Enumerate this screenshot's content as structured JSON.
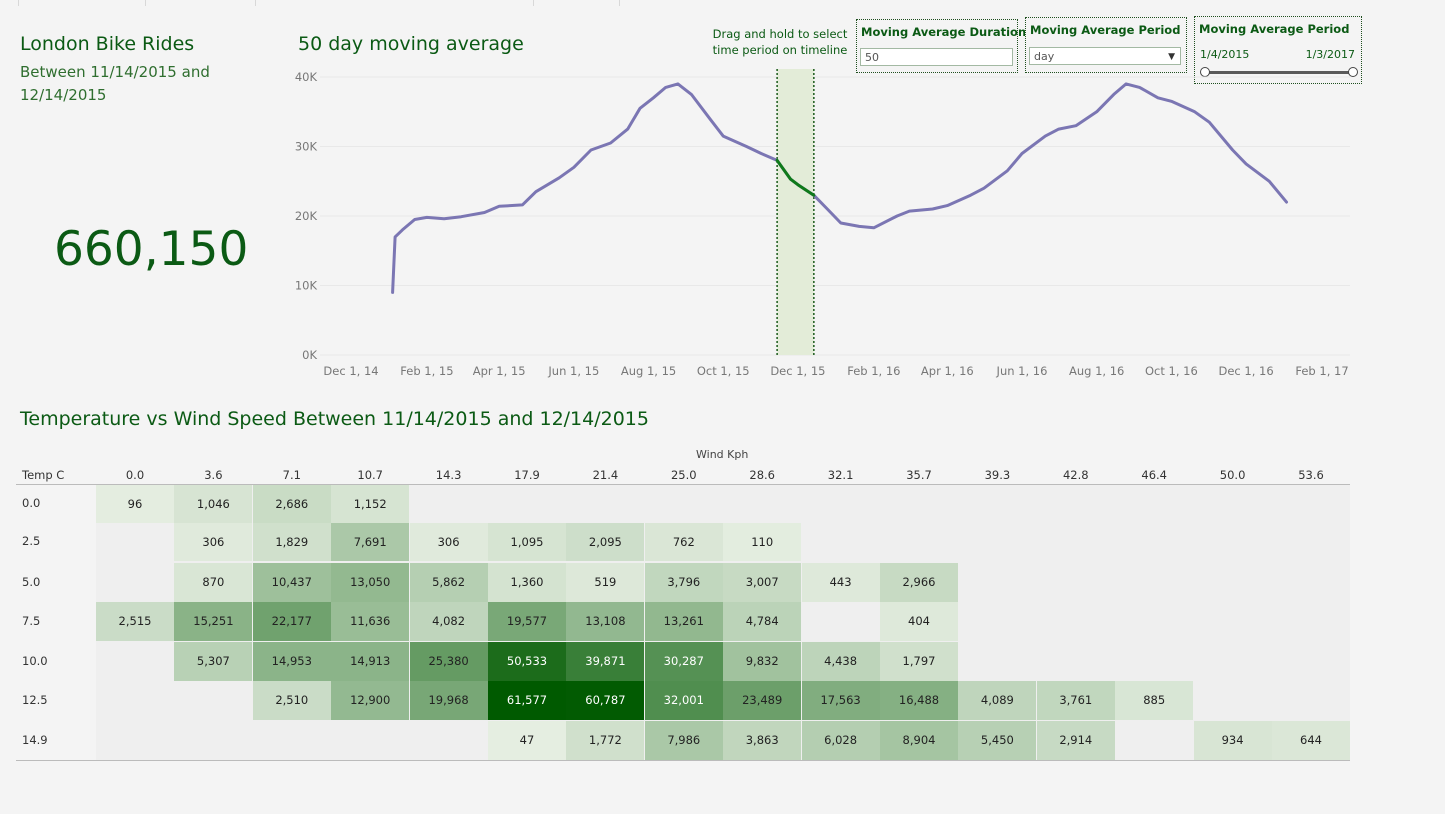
{
  "header": {
    "title": "London Bike Rides",
    "subtitle": "Between 11/14/2015 and 12/14/2015",
    "kpi_value": "660,150"
  },
  "line_chart": {
    "title": "50 day moving average",
    "hint": "Drag and hold to select time period on timeline"
  },
  "params": {
    "duration": {
      "label": "Moving Average Duration",
      "value": "50"
    },
    "period": {
      "label": "Moving Average Period",
      "value": "day"
    },
    "range": {
      "label": "Moving Average Period",
      "start": "1/4/2015",
      "end": "1/3/2017"
    }
  },
  "heatmap": {
    "title": "Temperature vs Wind Speed Between 11/14/2015 and 12/14/2015",
    "x_title": "Wind Kph",
    "y_title": "Temp C"
  },
  "colors": {
    "line": "#7b76b3",
    "highlight_line": "#0f7a1a",
    "selection_band": "#e3ecd8",
    "title_green": "#0b5a14",
    "heat_low": "#e7efe3",
    "heat_high": "#005a00"
  },
  "chart_data": [
    {
      "type": "line",
      "title": "50 day moving average",
      "x_ticks": [
        "Dec 1, 14",
        "Feb 1, 15",
        "Apr 1, 15",
        "Jun 1, 15",
        "Aug 1, 15",
        "Oct 1, 15",
        "Dec 1, 15",
        "Feb 1, 16",
        "Apr 1, 16",
        "Jun 1, 16",
        "Aug 1, 16",
        "Oct 1, 16",
        "Dec 1, 16",
        "Feb 1, 17"
      ],
      "y_ticks": [
        "0K",
        "10K",
        "20K",
        "30K",
        "40K"
      ],
      "ylim": [
        0,
        40000
      ],
      "xlim": [
        "2014-12-01",
        "2017-02-01"
      ],
      "selection": {
        "start": "2015-11-14",
        "end": "2015-12-14"
      },
      "series": [
        {
          "x": [
            "2015-01-04",
            "2015-01-06",
            "2015-01-12",
            "2015-01-22",
            "2015-02-01",
            "2015-02-15",
            "2015-03-01",
            "2015-03-20",
            "2015-04-01",
            "2015-04-20",
            "2015-05-01",
            "2015-05-20",
            "2015-06-01",
            "2015-06-15",
            "2015-07-01",
            "2015-07-15",
            "2015-07-25",
            "2015-08-05",
            "2015-08-15",
            "2015-08-25",
            "2015-09-05",
            "2015-09-20",
            "2015-10-01",
            "2015-10-20",
            "2015-11-01",
            "2015-11-14",
            "2015-11-25",
            "2015-12-01",
            "2015-12-14",
            "2015-12-25",
            "2016-01-05",
            "2016-01-20",
            "2016-02-01",
            "2016-02-20",
            "2016-03-01",
            "2016-03-20",
            "2016-04-01",
            "2016-04-20",
            "2016-05-01",
            "2016-05-20",
            "2016-06-01",
            "2016-06-20",
            "2016-07-01",
            "2016-07-15",
            "2016-08-01",
            "2016-08-15",
            "2016-08-25",
            "2016-09-05",
            "2016-09-20",
            "2016-10-01",
            "2016-10-20",
            "2016-11-01",
            "2016-11-20",
            "2016-12-01",
            "2016-12-20",
            "2017-01-03"
          ],
          "y": [
            9000,
            17000,
            18000,
            19500,
            19800,
            19600,
            19900,
            20500,
            21400,
            21600,
            23500,
            25500,
            27000,
            29500,
            30500,
            32500,
            35500,
            37000,
            38500,
            39000,
            37500,
            34000,
            31500,
            30000,
            29000,
            28000,
            25300,
            24500,
            23000,
            21000,
            19000,
            18500,
            18300,
            20000,
            20700,
            21000,
            21500,
            23000,
            24000,
            26500,
            29000,
            31500,
            32500,
            33000,
            35000,
            37500,
            39000,
            38500,
            37000,
            36500,
            35000,
            33500,
            29500,
            27500,
            25000,
            22000
          ]
        }
      ]
    },
    {
      "type": "heatmap",
      "title": "Temperature vs Wind Speed Between 11/14/2015 and 12/14/2015",
      "xlabel": "Wind Kph",
      "ylabel": "Temp C",
      "x": [
        "0.0",
        "3.6",
        "7.1",
        "10.7",
        "14.3",
        "17.9",
        "21.4",
        "25.0",
        "28.6",
        "32.1",
        "35.7",
        "39.3",
        "42.8",
        "46.4",
        "50.0",
        "53.6"
      ],
      "y": [
        "0.0",
        "2.5",
        "5.0",
        "7.5",
        "10.0",
        "12.5",
        "14.9"
      ],
      "values": [
        [
          96,
          1046,
          2686,
          1152,
          null,
          null,
          null,
          null,
          null,
          null,
          null,
          null,
          null,
          null,
          null,
          null
        ],
        [
          null,
          306,
          1829,
          7691,
          306,
          1095,
          2095,
          762,
          110,
          null,
          null,
          null,
          null,
          null,
          null,
          null
        ],
        [
          null,
          870,
          10437,
          13050,
          5862,
          1360,
          519,
          3796,
          3007,
          443,
          2966,
          null,
          null,
          null,
          null,
          null
        ],
        [
          2515,
          15251,
          22177,
          11636,
          4082,
          19577,
          13108,
          13261,
          4784,
          null,
          404,
          null,
          null,
          null,
          null,
          null
        ],
        [
          null,
          5307,
          14953,
          14913,
          25380,
          50533,
          39871,
          30287,
          9832,
          4438,
          1797,
          null,
          null,
          null,
          null,
          null
        ],
        [
          null,
          null,
          2510,
          12900,
          19968,
          61577,
          60787,
          32001,
          23489,
          17563,
          16488,
          4089,
          3761,
          885,
          null,
          null
        ],
        [
          null,
          null,
          null,
          null,
          null,
          47,
          1772,
          7986,
          3863,
          6028,
          8904,
          5450,
          2914,
          null,
          934,
          644
        ]
      ]
    }
  ]
}
